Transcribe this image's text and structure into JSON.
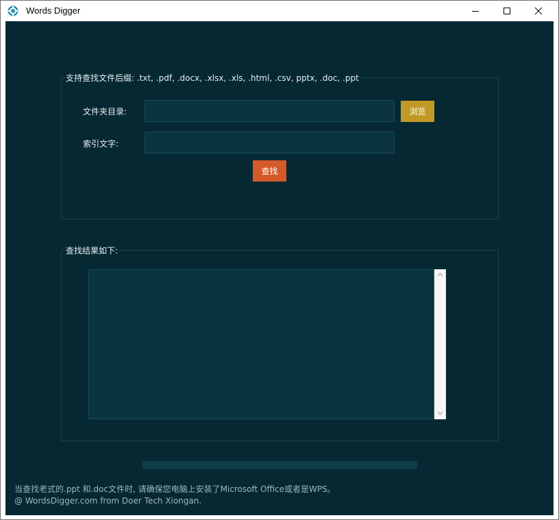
{
  "window": {
    "title": "Words Digger",
    "icon": "app-gear-icon",
    "controls": {
      "minimize": "minimize-icon",
      "maximize": "maximize-icon",
      "close": "close-icon"
    }
  },
  "search_group": {
    "legend": "支持查找文件后缀: .txt, .pdf, .docx, .xlsx, .xls, .html, .csv, pptx, .doc, .ppt",
    "folder_label": "文件夹目录:",
    "folder_value": "",
    "browse_label": "浏览",
    "keyword_label": "索引文字:",
    "keyword_value": "",
    "search_label": "查找"
  },
  "results_group": {
    "legend": "查找结果如下:",
    "content": ""
  },
  "progress": {
    "value": 0
  },
  "footer": {
    "line1": "当查找老式的.ppt 和.doc文件时, 请确保您电脑上安装了Microsoft Office或者是WPS。",
    "line2": "@ WordsDigger.com from Doer Tech Xiongan."
  },
  "colors": {
    "background": "#062832",
    "browse_button": "#c09a24",
    "search_button": "#d45a2a",
    "input_bg": "#0a3440"
  }
}
